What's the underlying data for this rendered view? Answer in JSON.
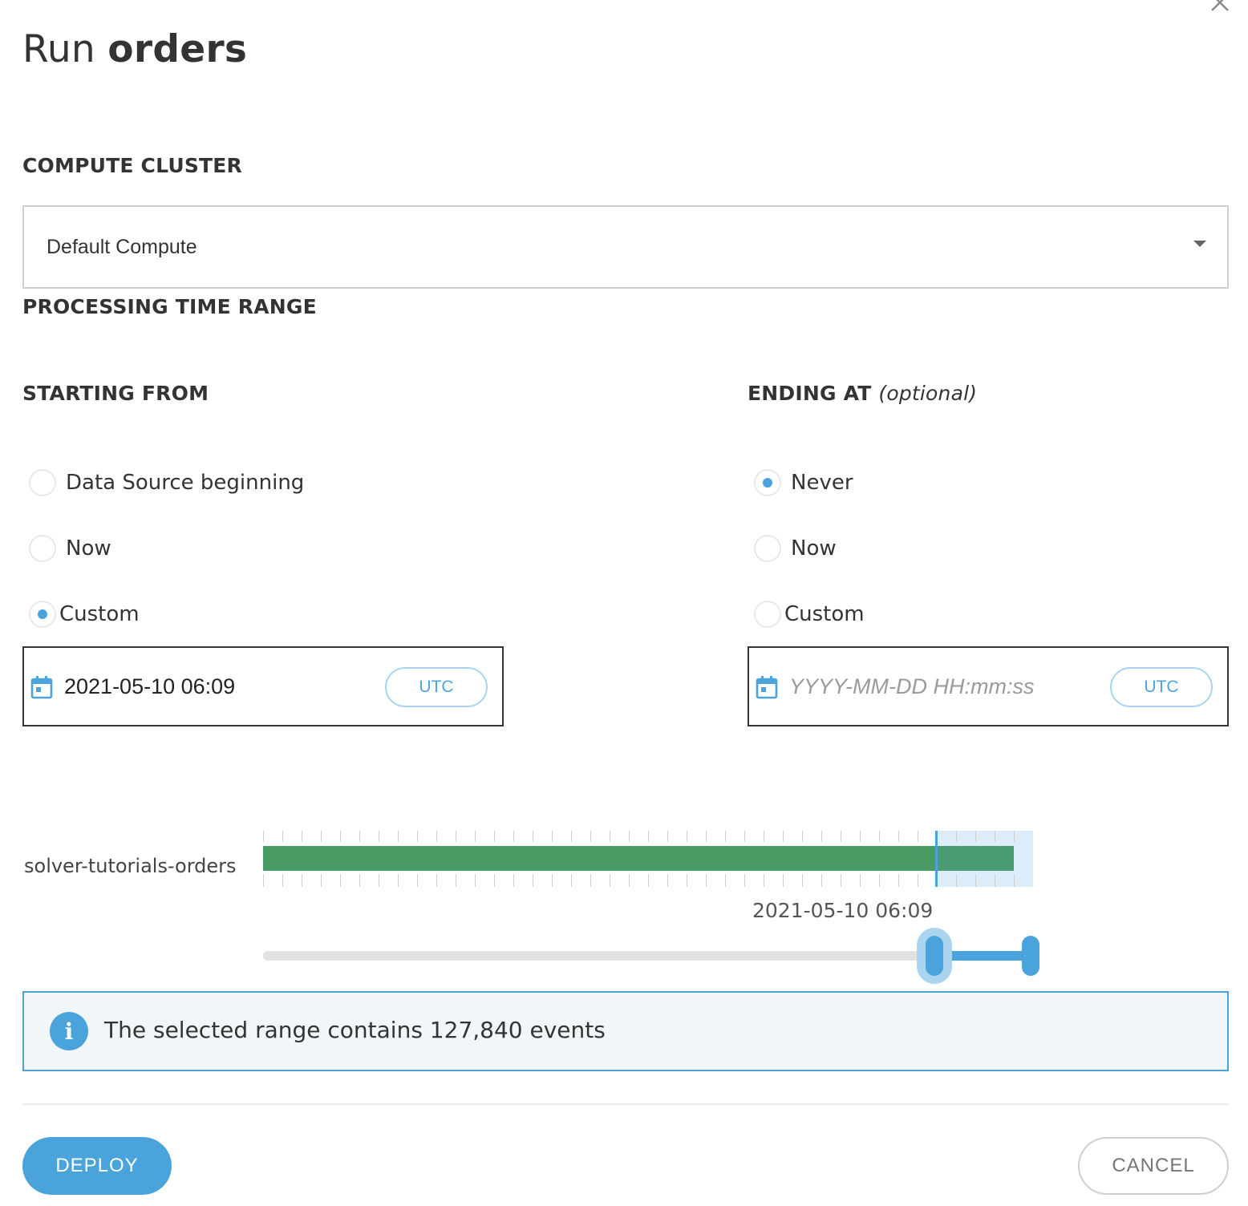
{
  "dialog": {
    "title_plain": "Run ",
    "title_bold": "orders"
  },
  "compute_cluster": {
    "label": "COMPUTE CLUSTER",
    "selected": "Default Compute"
  },
  "processing_time_range": {
    "label": "PROCESSING TIME RANGE"
  },
  "starting_from": {
    "label": "STARTING FROM",
    "options": [
      {
        "label": "Data Source beginning",
        "checked": false
      },
      {
        "label": "Now",
        "checked": false
      },
      {
        "label": "Custom",
        "checked": true
      }
    ],
    "date_value": "2021-05-10 06:09",
    "date_placeholder": "",
    "timezone": "UTC"
  },
  "ending_at": {
    "label": "ENDING AT",
    "label_suffix": "(optional)",
    "options": [
      {
        "label": "Never",
        "checked": true
      },
      {
        "label": "Now",
        "checked": false
      },
      {
        "label": "Custom",
        "checked": false
      }
    ],
    "date_value": "",
    "date_placeholder": "YYYY-MM-DD HH:mm:ss",
    "timezone": "UTC"
  },
  "timeline": {
    "source_name": "solver-tutorials-orders",
    "selected_start_label": "2021-05-10 06:09",
    "data_coverage_fraction": 0.975,
    "selection_start_fraction": 0.874,
    "selection_end_fraction": 1.0,
    "colors": {
      "data_bar": "#4a9a63",
      "selection": "#4ba3dc"
    }
  },
  "info": {
    "icon": "info-icon",
    "message": "The selected range contains 127,840 events"
  },
  "footer": {
    "deploy_label": "DEPLOY",
    "cancel_label": "CANCEL"
  },
  "theme": {
    "accent": "#4ba3dc",
    "text": "#333333"
  }
}
